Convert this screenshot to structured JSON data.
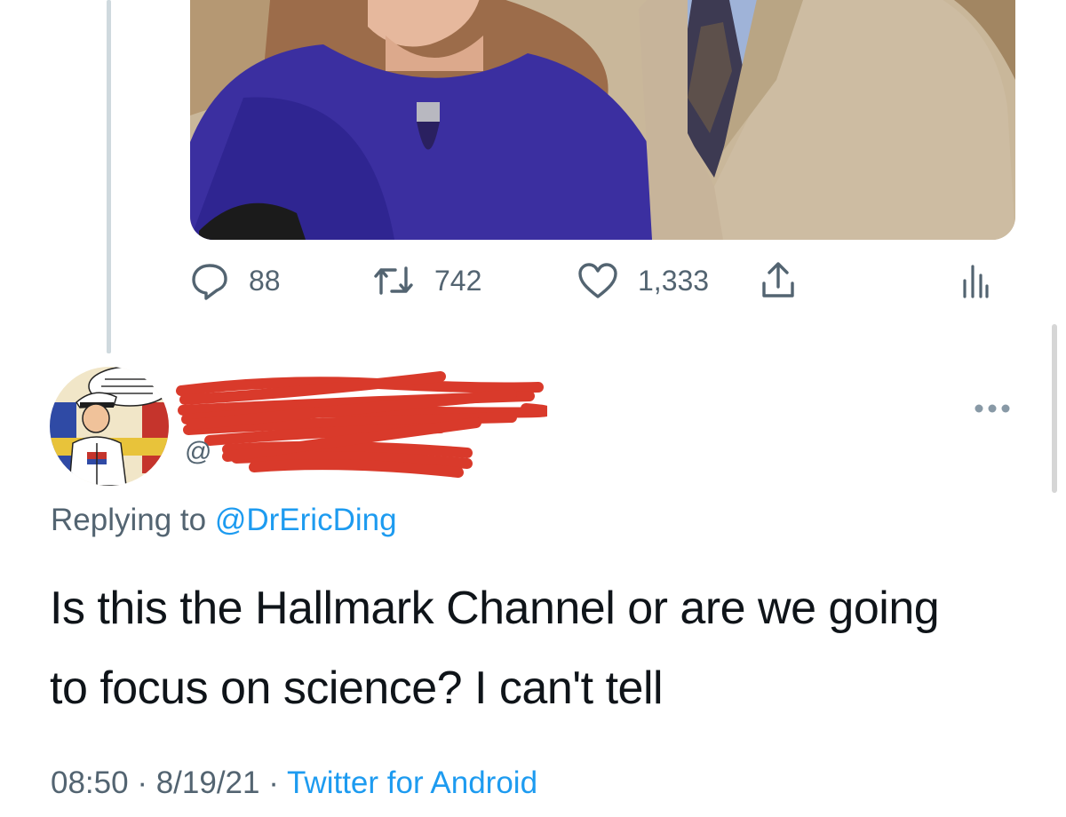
{
  "tweet_actions": {
    "replies": "88",
    "retweets": "742",
    "likes": "1,333"
  },
  "reply_tweet": {
    "handle_prefix": "@",
    "replying_label": "Replying to",
    "replying_to": "@DrEricDing",
    "text": "Is this the Hallmark Channel or are we going to focus on science? I can't tell",
    "time": "08:50",
    "date": "8/19/21",
    "source": "Twitter for Android",
    "separator": " · "
  },
  "icons": {
    "reply": "reply-icon",
    "retweet": "retweet-icon",
    "like": "like-icon",
    "share": "share-icon",
    "analytics": "analytics-icon",
    "more": "more-icon"
  },
  "colors": {
    "link": "#1d9bf0",
    "secondary_text": "#536471",
    "redaction": "#d93a2b"
  }
}
